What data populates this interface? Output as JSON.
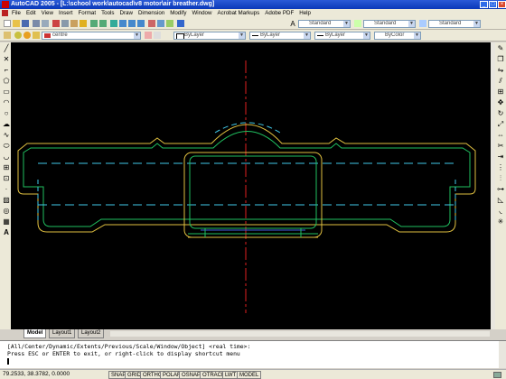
{
  "window": {
    "title": "AutoCAD 2005 - [L:\\school work\\autocad\\v8 motor\\air breather.dwg]",
    "minimize": "_",
    "maximize": "□",
    "close": "×"
  },
  "menubar": {
    "items": [
      "File",
      "Edit",
      "View",
      "Insert",
      "Format",
      "Tools",
      "Draw",
      "Dimension",
      "Modify",
      "Window",
      "Acrobat Markups",
      "Adobe PDF",
      "Help"
    ]
  },
  "toolbars": {
    "text_style": "Standard",
    "dim_style": "Standard",
    "table_style": "Standard",
    "layer": "centre",
    "color": "ByLayer",
    "linetype": "ByLayer",
    "lineweight": "ByLayer",
    "plotstyle": "ByColor"
  },
  "tabs": [
    "Model",
    "Layout1",
    "Layout2"
  ],
  "command": {
    "line1": "[All/Center/Dynamic/Extents/Previous/Scale/Window/Object] <real time>:",
    "line2": "Press ESC or ENTER to exit, or right-click to display shortcut menu"
  },
  "status": {
    "coords": "79.2533, 38.3782, 0.0000",
    "buttons": [
      "SNAP",
      "GRID",
      "ORTHO",
      "POLAR",
      "OSNAP",
      "OTRACK",
      "LWT",
      "MODEL"
    ]
  },
  "colors": {
    "drawing_bg": "#000000",
    "outline_yellow": "#e0c040",
    "outline_green": "#20c060",
    "hidden_cyan": "#40c8e8",
    "centerline_red": "#e02020"
  }
}
